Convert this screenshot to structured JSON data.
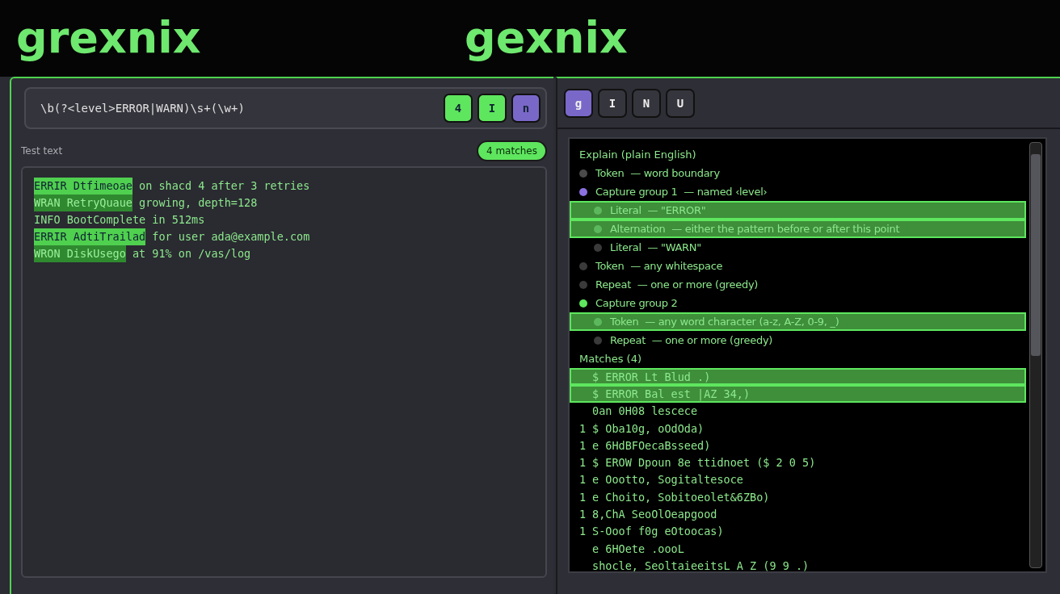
{
  "titles": [
    "grexnix",
    "gexnix"
  ],
  "pattern": {
    "value": "\\b(?<level>ERROR|WARN)\\s+(\\w+)"
  },
  "left_buttons": [
    {
      "label": "4",
      "color": "#5ee65e"
    },
    {
      "label": "I",
      "color": "#5ee65e"
    },
    {
      "label": "n",
      "color": "#7a68c8"
    }
  ],
  "test_text": {
    "label": "Test text",
    "badge": "4 matches",
    "lines": [
      {
        "match": "ERRIR Dtfimeoae",
        "rest": " on shacd 4 after 3 retries",
        "kind": "bright"
      },
      {
        "match": "WRAN RetryQuaue",
        "rest": " growing, depth=128",
        "kind": "dim"
      },
      {
        "rest": "INFO BootComplete in 512ms",
        "kind": "plain"
      },
      {
        "match": "ERRIR AdtiTrailad",
        "rest": " for user ada@example.com",
        "kind": "bright"
      },
      {
        "match": "WRON DiskUsego",
        "rest": " at 91% on /vas/log",
        "kind": "dim"
      }
    ]
  },
  "right_buttons": [
    {
      "label": "g",
      "color": "#7a68c8"
    },
    {
      "label": "I",
      "color": "#35353d"
    },
    {
      "label": "N",
      "color": "#35353d"
    },
    {
      "label": "U",
      "color": "#35353d"
    }
  ],
  "explain": {
    "title": "Explain (plain English)",
    "items": [
      {
        "label": "Token",
        "desc": "— word boundary",
        "color": "#4a4a4a",
        "highlighted": false
      },
      {
        "label": "Capture group 1",
        "desc": "— named ‹level›",
        "color": "#8a70e0",
        "highlighted": false,
        "children": [
          {
            "label": "Literal",
            "desc": "— \"ERROR\"",
            "color": "#5cb85c",
            "highlighted": true
          },
          {
            "label": "Alternation",
            "desc": "— either the pattern before or after this point",
            "color": "#5cb85c",
            "highlighted": true
          },
          {
            "label": "Literal",
            "desc": "— \"WARN\"",
            "color": "#3a3a3a",
            "highlighted": false
          }
        ]
      },
      {
        "label": "Token",
        "desc": "— any whitespace",
        "color": "#3a3a3a",
        "highlighted": false
      },
      {
        "label": "Repeat",
        "desc": "— one or more (greedy)",
        "color": "#3a3a3a",
        "highlighted": false
      },
      {
        "label": "Capture group 2",
        "color": "#5ee65e",
        "highlighted": false,
        "children": [
          {
            "label": "Token",
            "desc": "— any word character (a-z, A-Z, 0-9, _)",
            "color": "#5cb85c",
            "highlighted": true
          },
          {
            "label": "Repeat",
            "desc": "— one or more (greedy)",
            "color": "#3a3a3a",
            "highlighted": false
          }
        ]
      }
    ]
  },
  "matches": {
    "title": "Matches (4)",
    "rows": [
      {
        "text": "$ ERROR Lt Blud .)",
        "highlighted": true
      },
      {
        "text": "$ ERROR Bal est |AZ 34,)",
        "highlighted": true
      },
      {
        "text": "0an 0H08 lescece",
        "highlighted": false
      },
      {
        "gutter": "1",
        "text": "$ Oba10g, oOdOda)",
        "highlighted": false
      },
      {
        "gutter": "1",
        "text": "e 6HdBFOecaBsseed)",
        "highlighted": false
      },
      {
        "gutter": "1",
        "text": "$ EROW Dpoun 8e ttidnoet ($ 2 0 5)",
        "highlighted": false
      },
      {
        "gutter": "1",
        "text": "e Oootto, Sogitaltesoce",
        "highlighted": false
      },
      {
        "gutter": "1",
        "text": "e Choito, Sobitoeolet&6ZBo)",
        "highlighted": false
      },
      {
        "gutter": "1",
        "text": "8,ChA SeoOlOeapgood",
        "highlighted": false
      },
      {
        "gutter": "1",
        "text": "S-Ooof f0g eOtoocas)",
        "highlighted": false
      },
      {
        "text": "e 6HOete .oooL",
        "highlighted": false
      },
      {
        "text": "shocle, SeoltaieeitsL A Z (9 9 .)",
        "highlighted": false
      }
    ]
  }
}
